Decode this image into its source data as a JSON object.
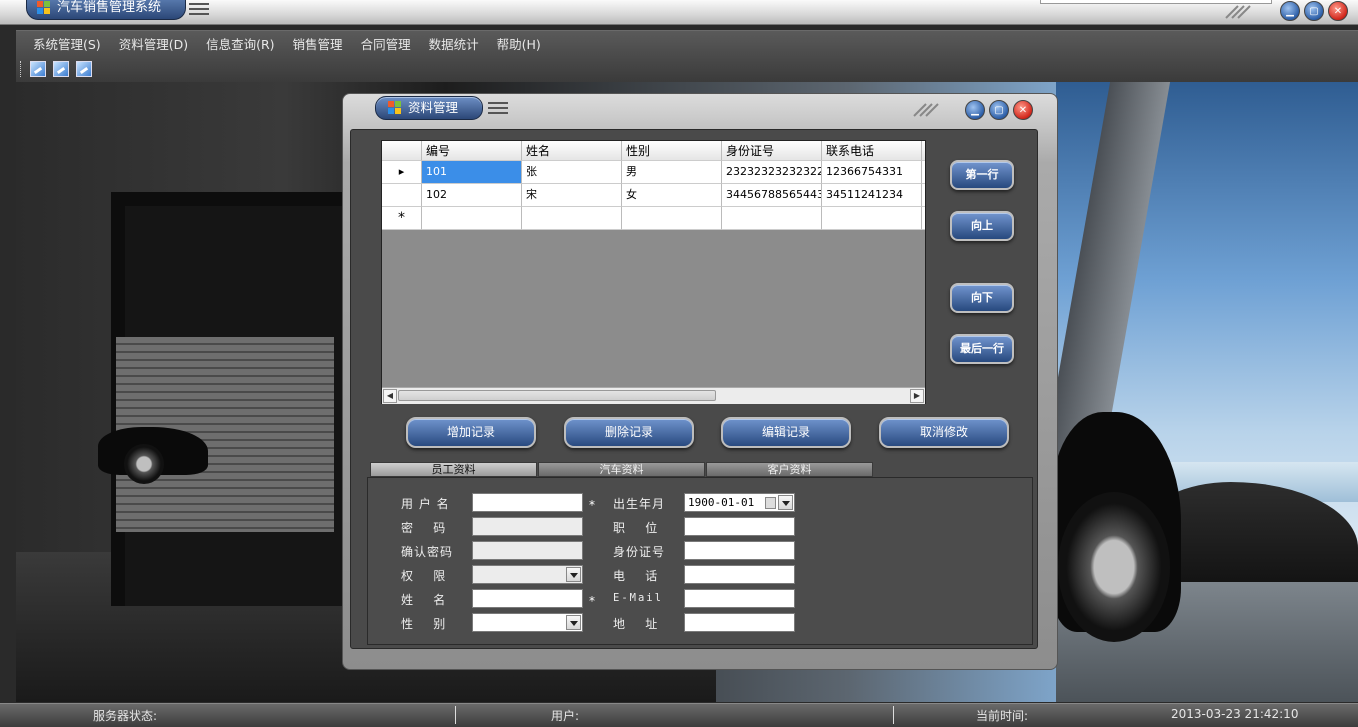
{
  "app": {
    "title": "汽车销售管理系统"
  },
  "menu": [
    "系统管理(S)",
    "资料管理(D)",
    "信息查询(R)",
    "销售管理",
    "合同管理",
    "数据统计",
    "帮助(H)"
  ],
  "child_window": {
    "title": "资料管理"
  },
  "grid": {
    "columns": [
      "编号",
      "姓名",
      "性别",
      "身份证号",
      "联系电话"
    ],
    "rows": [
      [
        "101",
        "张",
        "男",
        "23232323232322",
        "12366754331"
      ],
      [
        "102",
        "宋",
        "女",
        "34456788565443",
        "34511241234"
      ]
    ],
    "new_row_marker": "*"
  },
  "nav_buttons": {
    "first": "第一行",
    "up": "向上",
    "down": "向下",
    "last": "最后一行"
  },
  "actions": {
    "add": "增加记录",
    "delete": "删除记录",
    "edit": "编辑记录",
    "cancel": "取消修改"
  },
  "tabs": [
    "员工资料",
    "汽车资料",
    "客户资料"
  ],
  "form": {
    "labels_left": [
      "用 户 名",
      "密    码",
      "确认密码",
      "权    限",
      "姓    名",
      "性    别"
    ],
    "labels_right": [
      "出生年月",
      "职    位",
      "身份证号",
      "电    话",
      "E-Mail",
      "地    址"
    ],
    "birth_date": "1900-01-01",
    "required_marker": "*"
  },
  "status": {
    "server_label": "服务器状态:",
    "user_label": "用户:",
    "time_label": "当前时间:",
    "time_value": "2013-03-23 21:42:10"
  }
}
